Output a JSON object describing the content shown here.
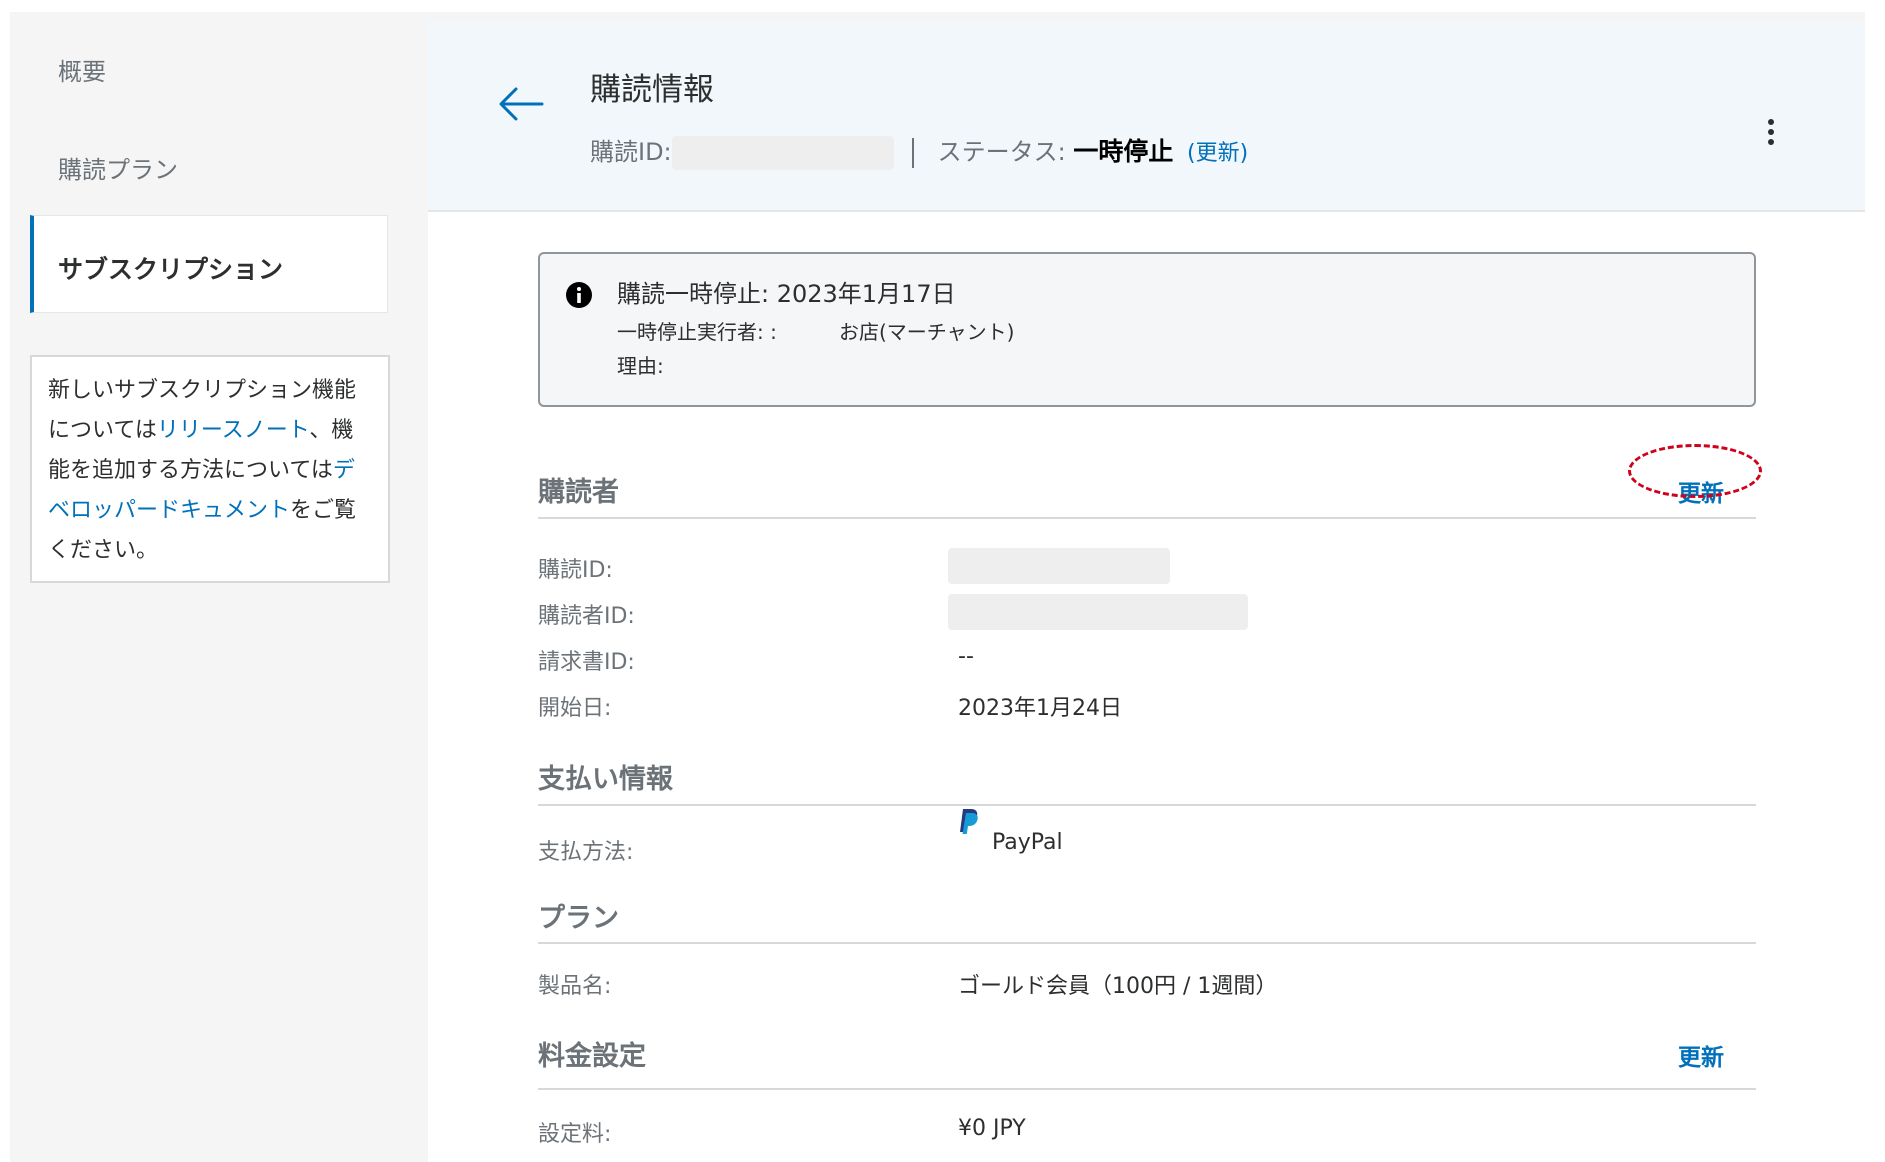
{
  "sidebar": {
    "items": [
      {
        "label": "概要"
      },
      {
        "label": "購読プラン"
      },
      {
        "label": "サブスクリプション"
      }
    ],
    "notice": {
      "part1": "新しいサブスクリプション機能については",
      "link1": "リリースノート",
      "part2": "、機能を追加する方法については",
      "link2": "デベロッパードキュメント",
      "part3": "をご覧ください。"
    }
  },
  "header": {
    "title": "購読情報",
    "subscription_id_label": "購読ID:",
    "status_label": "ステータス:",
    "status_value": "一時停止",
    "status_update": "(更新)"
  },
  "alert": {
    "title": "購読一時停止: 2023年1月17日",
    "paused_by_label": "一時停止実行者: :",
    "paused_by_value": "お店(マーチャント)",
    "reason_label": "理由:"
  },
  "subscriber": {
    "title": "購読者",
    "update_label": "更新",
    "rows": [
      {
        "label": "購読ID:"
      },
      {
        "label": "購読者ID:"
      },
      {
        "label": "請求書ID:",
        "value": "--"
      },
      {
        "label": "開始日:",
        "value": "2023年1月24日"
      }
    ]
  },
  "payment": {
    "title": "支払い情報",
    "method_label": "支払方法:",
    "method_value": "PayPal"
  },
  "plan": {
    "title": "プラン",
    "product_label": "製品名:",
    "product_value": "ゴールド会員（100円 / 1週間）"
  },
  "pricing": {
    "title": "料金設定",
    "update_label": "更新",
    "setup_fee_label": "設定料:",
    "setup_fee_value": "¥0 JPY"
  },
  "colors": {
    "link": "#0070ba",
    "header_bg": "#f2f7fb",
    "highlight": "#d0021b"
  },
  "icons": [
    "back-arrow-icon",
    "kebab-menu-icon",
    "info-icon",
    "paypal-icon"
  ]
}
